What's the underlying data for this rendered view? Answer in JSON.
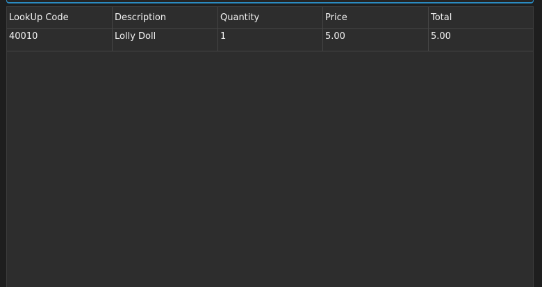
{
  "grid": {
    "columns": [
      {
        "label": "LookUp Code"
      },
      {
        "label": "Description"
      },
      {
        "label": "Quantity"
      },
      {
        "label": "Price"
      },
      {
        "label": "Total"
      }
    ],
    "rows": [
      {
        "lookup_code": "40010",
        "description": "Lolly Doll",
        "quantity": "1",
        "price": "5.00",
        "total": "5.00"
      }
    ]
  },
  "colors": {
    "background": "#2d2d2d",
    "header_text": "#f2f2f2",
    "accent_border": "#2a8bc2",
    "grid_line": "#464646"
  }
}
